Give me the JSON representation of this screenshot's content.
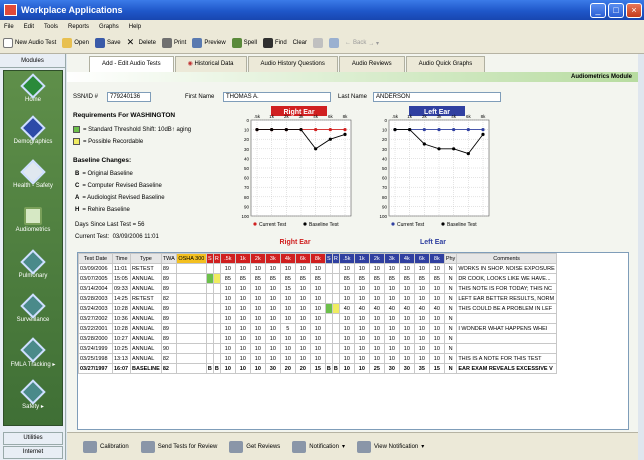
{
  "window": {
    "title": "Workplace Applications"
  },
  "menu": [
    "File",
    "Edit",
    "Tools",
    "Reports",
    "Graphs",
    "Help"
  ],
  "toolbar": [
    {
      "label": "New Audio Test",
      "icon": "new-file-icon",
      "color": "#ffffff"
    },
    {
      "label": "Open",
      "icon": "folder-icon",
      "color": "#e8c050"
    },
    {
      "label": "Save",
      "icon": "save-icon",
      "color": "#3a5aa8"
    },
    {
      "label": "Delete",
      "icon": "delete-icon",
      "color": "#000000"
    },
    {
      "label": "Print",
      "icon": "printer-icon",
      "color": "#707070"
    },
    {
      "label": "Preview",
      "icon": "preview-icon",
      "color": "#5a7ab0"
    },
    {
      "label": "Spell",
      "icon": "spellcheck-icon",
      "color": "#5a8a3a"
    },
    {
      "label": "Find",
      "icon": "binoculars-icon",
      "color": "#303030"
    },
    {
      "label": "Clear",
      "icon": "clear-icon",
      "color": "#c0c0c0"
    }
  ],
  "toolbar_back": "Back",
  "modules": {
    "header": "Modules",
    "items": [
      "Home",
      "Demographics",
      "Health - Safety",
      "Audiometrics",
      "Pulmonary",
      "Surveillance",
      "FMLA Tracking",
      "Safety"
    ],
    "footer": [
      "Utilities",
      "Internet"
    ]
  },
  "tabs": [
    "Add - Edit Audio Tests",
    "Historical Data",
    "Audio History Questions",
    "Audio Reviews",
    "Audio Quick Graphs"
  ],
  "module_title": "Audiometrics Module",
  "ssn": {
    "label": "SSN/ID #",
    "value": "779240136"
  },
  "first_name": {
    "label": "First Name",
    "value": "THOMAS A."
  },
  "last_name": {
    "label": "Last Name",
    "value": "ANDERSON"
  },
  "requirements": {
    "title": "Requirements For WASHINGTON",
    "sts": "= Standard Threshold Shift: 10dB↑ aging",
    "recordable": "= Possible Recordable",
    "sts_color": "#6cc04a",
    "recordable_color": "#f0ec60"
  },
  "baseline": {
    "title": "Baseline Changes:",
    "items": [
      {
        "code": "B",
        "text": "= Original Baseline"
      },
      {
        "code": "C",
        "text": "= Computer Revised Baseline"
      },
      {
        "code": "A",
        "text": "= Audiologist Revised Baseline"
      },
      {
        "code": "H",
        "text": "= Rehire Baseline"
      }
    ],
    "days_label": "Days Since Last Test =",
    "days_value": "56",
    "current_label": "Current Test:",
    "current_value": "03/09/2006  11:01"
  },
  "chart_data": [
    {
      "type": "line",
      "title": "Right Ear",
      "caption": "Right Ear",
      "x": [
        "500",
        "1k",
        "2k",
        "3k",
        "4k",
        "6k",
        "8k"
      ],
      "tick_labels_top": [
        ".5k",
        "1k",
        "2k",
        "3k",
        "4k",
        "6k",
        "8k"
      ],
      "ylim": [
        0,
        100
      ],
      "yticks": [
        0,
        10,
        20,
        30,
        40,
        50,
        60,
        70,
        80,
        90,
        100
      ],
      "inverted_y": true,
      "series": [
        {
          "name": "Current Test",
          "color": "#d02020",
          "values": [
            10,
            10,
            10,
            10,
            10,
            10,
            10
          ]
        },
        {
          "name": "Baseline Test",
          "color": "#000000",
          "values": [
            10,
            10,
            10,
            10,
            30,
            20,
            15
          ]
        }
      ],
      "grid": true,
      "legend": "bottom"
    },
    {
      "type": "line",
      "title": "Left Ear",
      "caption": "Left Ear",
      "x": [
        "500",
        "1k",
        "2k",
        "3k",
        "4k",
        "6k",
        "8k"
      ],
      "tick_labels_top": [
        ".5k",
        "1k",
        "2k",
        "3k",
        "4k",
        "6k",
        "8k"
      ],
      "ylim": [
        0,
        100
      ],
      "yticks": [
        0,
        10,
        20,
        30,
        40,
        50,
        60,
        70,
        80,
        90,
        100
      ],
      "inverted_y": true,
      "series": [
        {
          "name": "Current Test",
          "color": "#3040a0",
          "values": [
            10,
            10,
            10,
            10,
            10,
            10,
            10
          ]
        },
        {
          "name": "Baseline Test",
          "color": "#000000",
          "values": [
            10,
            10,
            25,
            30,
            30,
            35,
            15
          ]
        }
      ],
      "grid": true,
      "legend": "bottom"
    }
  ],
  "table": {
    "columns": [
      "Test Date",
      "Time",
      "Type",
      "TWA",
      "OSHA 300",
      "S",
      "R",
      ".5k",
      "1k",
      "2k",
      "3k",
      "4k",
      "6k",
      "8k",
      "S",
      "R",
      ".5k",
      "1k",
      "2k",
      "3k",
      "4k",
      "6k",
      "8k",
      "Phy",
      "Comments"
    ],
    "rows": [
      [
        "03/09/2006",
        "11:01",
        "RETEST",
        "89",
        "",
        "",
        "",
        "10",
        "10",
        "10",
        "10",
        "10",
        "10",
        "10",
        "",
        "",
        "10",
        "10",
        "10",
        "10",
        "10",
        "10",
        "10",
        "N",
        "WORKS IN SHOP. NOISE EXPOSURE"
      ],
      [
        "03/07/2005",
        "15:05",
        "ANNUAL",
        "89",
        "",
        "",
        "",
        "85",
        "85",
        "85",
        "85",
        "85",
        "85",
        "85",
        "",
        "",
        "85",
        "85",
        "85",
        "85",
        "85",
        "85",
        "85",
        "N",
        "DR COOK,  LOOKS LIKE WE HAVE..."
      ],
      [
        "03/14/2004",
        "09:33",
        "ANNUAL",
        "89",
        "",
        "",
        "",
        "10",
        "10",
        "10",
        "10",
        "15",
        "10",
        "10",
        "",
        "",
        "10",
        "10",
        "10",
        "10",
        "10",
        "10",
        "10",
        "N",
        "THIS NOTE IS FOR TODAY; THIS NC"
      ],
      [
        "03/28/2003",
        "14:25",
        "RETEST",
        "82",
        "",
        "",
        "",
        "10",
        "10",
        "10",
        "10",
        "10",
        "10",
        "10",
        "",
        "",
        "10",
        "10",
        "10",
        "10",
        "10",
        "10",
        "10",
        "N",
        "LEFT EAR BETTER RESULTS, NORM"
      ],
      [
        "03/24/2003",
        "10:28",
        "ANNUAL",
        "89",
        "",
        "",
        "",
        "10",
        "10",
        "10",
        "10",
        "10",
        "10",
        "10",
        "",
        "",
        "40",
        "40",
        "40",
        "40",
        "40",
        "40",
        "40",
        "N",
        "THIS COULD BE A PROBLEM IN LEF"
      ],
      [
        "03/27/2002",
        "10:36",
        "ANNUAL",
        "89",
        "",
        "",
        "",
        "10",
        "10",
        "10",
        "10",
        "10",
        "10",
        "10",
        "",
        "",
        "10",
        "10",
        "10",
        "10",
        "10",
        "10",
        "10",
        "N",
        ""
      ],
      [
        "03/22/2001",
        "10:28",
        "ANNUAL",
        "89",
        "",
        "",
        "",
        "10",
        "10",
        "10",
        "10",
        "5",
        "10",
        "10",
        "",
        "",
        "10",
        "10",
        "10",
        "10",
        "10",
        "10",
        "10",
        "N",
        "I WONDER WHAT HAPPENS WHEI"
      ],
      [
        "03/28/2000",
        "10:27",
        "ANNUAL",
        "89",
        "",
        "",
        "",
        "10",
        "10",
        "10",
        "10",
        "10",
        "10",
        "10",
        "",
        "",
        "10",
        "10",
        "10",
        "10",
        "10",
        "10",
        "10",
        "N",
        ""
      ],
      [
        "03/24/1999",
        "10:25",
        "ANNUAL",
        "90",
        "",
        "",
        "",
        "10",
        "10",
        "10",
        "10",
        "10",
        "10",
        "10",
        "",
        "",
        "10",
        "10",
        "10",
        "10",
        "10",
        "10",
        "10",
        "N",
        ""
      ],
      [
        "03/25/1998",
        "13:13",
        "ANNUAL",
        "82",
        "",
        "",
        "",
        "10",
        "10",
        "10",
        "10",
        "10",
        "10",
        "10",
        "",
        "",
        "10",
        "10",
        "10",
        "10",
        "10",
        "10",
        "10",
        "N",
        "THIS IS A NOTE FOR THIS TEST"
      ],
      [
        "03/27/1997",
        "16:07",
        "BASELINE",
        "82",
        "",
        "B",
        "B",
        "10",
        "10",
        "10",
        "30",
        "20",
        "20",
        "15",
        "B",
        "B",
        "10",
        "10",
        "25",
        "30",
        "30",
        "35",
        "15",
        "N",
        "EAR EXAM REVEALS EXCESSIVE V"
      ]
    ]
  },
  "footer_buttons": [
    "Calibration",
    "Send Tests for Review",
    "Get Reviews",
    "Notification",
    "View Notification"
  ]
}
